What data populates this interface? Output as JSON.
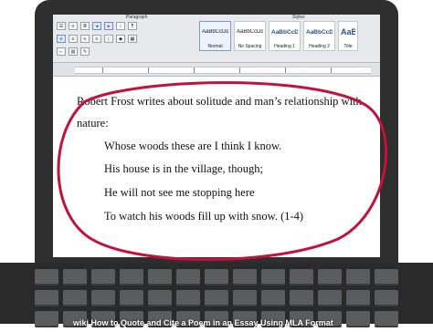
{
  "ribbon": {
    "group_paragraph": "Paragraph",
    "group_styles": "Styles",
    "styles": [
      {
        "sample": "AaBbCcDdEe",
        "name": "Normal",
        "selected": true,
        "heading": false
      },
      {
        "sample": "AaBbCcDdEe",
        "name": "No Spacing",
        "selected": false,
        "heading": false
      },
      {
        "sample": "AaBbCcDd",
        "name": "Heading 1",
        "selected": false,
        "heading": true
      },
      {
        "sample": "AaBbCcDdEe",
        "name": "Heading 2",
        "selected": false,
        "heading": true
      },
      {
        "sample": "AaBl",
        "name": "Title",
        "selected": false,
        "heading": true
      }
    ]
  },
  "document": {
    "line1": "Robert Frost writes about solitude and man’s relationship with",
    "line2": "nature:",
    "quote": [
      "Whose woods these are I think I know.",
      "His house is in the village, though;",
      "He will not see me stopping here",
      "To watch his woods fill up with snow. (1-4)"
    ]
  },
  "caption": "wiki How to Quote and Cite a Poem in an Essay Using MLA Format",
  "colors": {
    "circle": "#c2123a",
    "bezel": "#2f2f30"
  }
}
